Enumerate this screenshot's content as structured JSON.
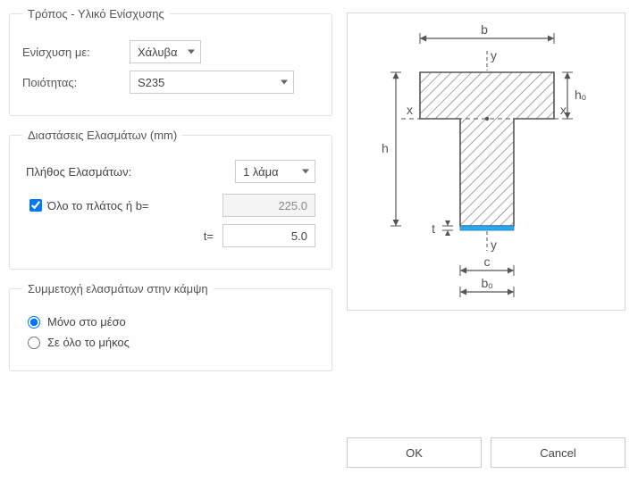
{
  "group1": {
    "legend": "Τρόπος - Υλικό Ενίσχυσης",
    "reinforceWithLabel": "Ενίσχυση με:",
    "reinforceWithValue": "Χάλυβα",
    "qualityLabel": "Ποιότητας:",
    "qualityValue": "S235"
  },
  "group2": {
    "legend": "Διαστάσεις Ελασμάτων (mm)",
    "countLabel": "Πλήθος Ελασμάτων:",
    "countValue": "1 λάμα",
    "fullWidthLabel": "Όλο το πλάτος  ή  b=",
    "fullWidthChecked": true,
    "bValue": "225.0",
    "tLabel": "t=",
    "tValue": "5.0"
  },
  "group3": {
    "legend": "Συμμετοχή ελασμάτων στην κάμψη",
    "opt1": "Μόνο στο μέσο",
    "opt2": "Σε όλο το μήκος",
    "selected": 1
  },
  "buttons": {
    "ok": "OK",
    "cancel": "Cancel"
  },
  "diagram": {
    "labels": {
      "b": "b",
      "yTop": "y",
      "yBot": "y",
      "xL": "x",
      "xR": "x",
      "h": "h",
      "ho": "hₒ",
      "t": "t",
      "c": "c",
      "bo": "bₒ"
    }
  }
}
